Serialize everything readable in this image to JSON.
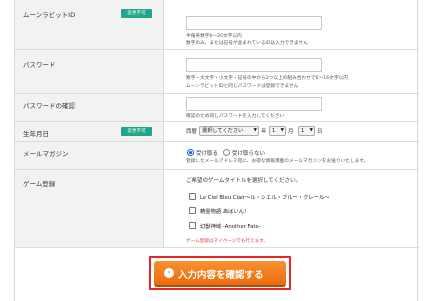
{
  "form": {
    "moon_id": {
      "label": "ムーンラビットID",
      "badge": "変更不可",
      "note1": "半角英数字6～20文字以内",
      "note2": "数字のみ、または記号が含まれているIDは入力できません"
    },
    "password": {
      "label": "パスワード",
      "note1": "数字・大文字・小文字・記号の中から2つ以上の組み合わせで6～16文字以内",
      "note2": "ムーンラビットIDと同じパスワードは登録できません"
    },
    "password_confirm": {
      "label": "パスワードの確認",
      "note": "確認のため同じパスワードを入力してください"
    },
    "birthday": {
      "label": "生年月日",
      "badge": "変更不可",
      "era_prefix": "西暦",
      "year_select": "選択してください",
      "year_suffix": "年",
      "month_select": "1",
      "month_suffix": "月",
      "day_select": "1",
      "day_suffix": "日"
    },
    "mail_magazine": {
      "label": "メールマガジン",
      "option_yes": "受け取る",
      "option_no": "受け取らない",
      "note": "登録したメールアドレス宛に、お得な情報満載のメールマガジンをお送りいたします。"
    },
    "game_registration": {
      "label": "ゲーム登録",
      "prompt": "ご希望のゲームタイトルを選択してください。",
      "games": [
        "Le Ciel Bleu Clair～ル・シエル・ブルー・クレール～",
        "精霊物語 あばいん！",
        "幻獣神域 -Another Fate-"
      ],
      "note": "ゲーム登録はマイページでも行えます。"
    }
  },
  "submit": {
    "label": "入力内容を確認する",
    "icon": "chevron-right-circle-icon"
  }
}
